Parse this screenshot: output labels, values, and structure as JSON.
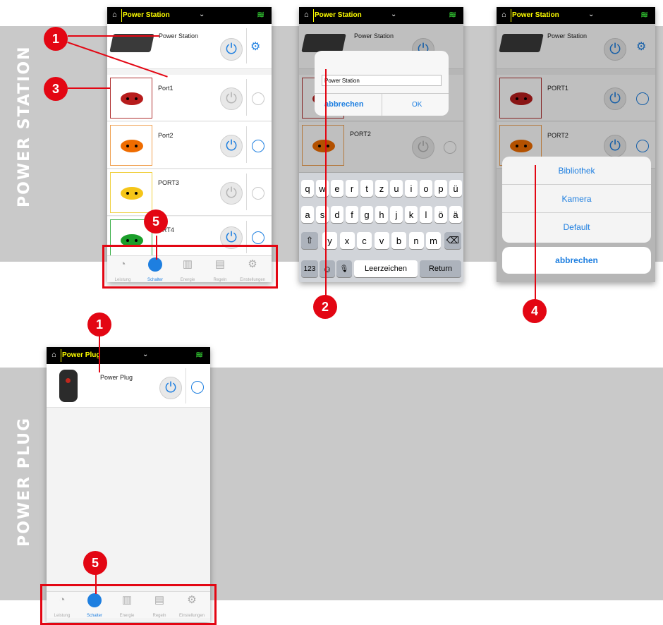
{
  "bands": {
    "station_label": "POWER STATION",
    "plug_label": "POWER PLUG"
  },
  "topbar": {
    "station_title": "Power Station",
    "plug_title": "Power Plug",
    "home_icon": "⌂",
    "chevron": "⌄",
    "wifi_icon": "≋"
  },
  "phone1": {
    "device_name": "Power Station",
    "ports": [
      {
        "label": "Port1",
        "color": "#b71c1c",
        "frame": "#b03030",
        "on": false
      },
      {
        "label": "Port2",
        "color": "#ef6c00",
        "frame": "#f0a050",
        "on": true
      },
      {
        "label": "PORT3",
        "color": "#f5c518",
        "frame": "#f0d040",
        "on": false
      },
      {
        "label": "RT4",
        "color": "#1b9e2a",
        "frame": "#3cb04a",
        "on": true
      }
    ]
  },
  "phone2": {
    "device_name": "Power Station",
    "dialog_input": "Power Station",
    "cancel": "abbrechen",
    "ok": "OK",
    "port2_label": "PORT2",
    "keys_row1": [
      "q",
      "w",
      "e",
      "r",
      "t",
      "z",
      "u",
      "i",
      "o",
      "p",
      "ü"
    ],
    "keys_row2": [
      "a",
      "s",
      "d",
      "f",
      "g",
      "h",
      "j",
      "k",
      "l",
      "ö",
      "ä"
    ],
    "keys_row3": [
      "y",
      "x",
      "c",
      "v",
      "b",
      "n",
      "m"
    ],
    "shift": "⇧",
    "backspace": "⌫",
    "num": "123",
    "emoji": "☺",
    "mic": "🎙",
    "space": "Leerzeichen",
    "return": "Return"
  },
  "phone3": {
    "device_name": "Power Station",
    "port1_label": "PORT1",
    "port2_label": "PORT2",
    "sheet": [
      "Bibliothek",
      "Kamera",
      "Default"
    ],
    "cancel": "abbrechen",
    "nav_partial": [
      "Leistung",
      "Schalter",
      "Energie",
      "Regeln",
      "Einstellungen"
    ]
  },
  "phone4": {
    "device_name": "Power Plug"
  },
  "nav": [
    {
      "label": "Leistung",
      "icon": "◔"
    },
    {
      "label": "Schalter",
      "icon": "●"
    },
    {
      "label": "Energie",
      "icon": "▥"
    },
    {
      "label": "Regeln",
      "icon": "▤"
    },
    {
      "label": "Einstellungen",
      "icon": "⚙"
    }
  ],
  "markers": {
    "m1": "1",
    "m2": "2",
    "m3": "3",
    "m4": "4",
    "m5": "5"
  },
  "power_glyph": "⏻",
  "gear_glyph": "⚙",
  "colors": {
    "accent": "#1e7fe0",
    "marker": "#e30613",
    "band": "#c9c9c9"
  }
}
